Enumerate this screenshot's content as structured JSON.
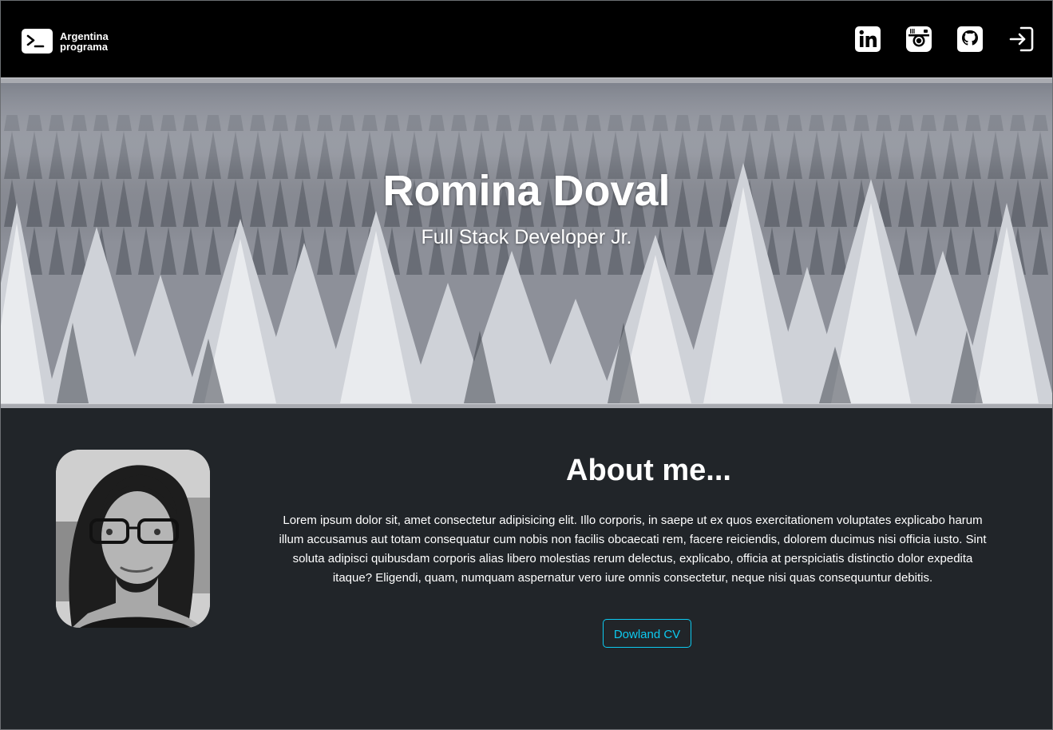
{
  "navbar": {
    "brand_line1": "Argentina",
    "brand_line2": "programa",
    "brand_icon": "terminal-icon",
    "icons": [
      {
        "name": "linkedin-icon",
        "label": "LinkedIn"
      },
      {
        "name": "instagram-icon",
        "label": "Instagram"
      },
      {
        "name": "github-icon",
        "label": "GitHub"
      },
      {
        "name": "login-icon",
        "label": "Login"
      }
    ]
  },
  "hero": {
    "title": "Romina Doval",
    "subtitle": "Full Stack Developer Jr."
  },
  "about": {
    "title": "About me...",
    "text": "Lorem ipsum dolor sit, amet consectetur adipisicing elit. Illo corporis, in saepe ut ex quos exercitationem voluptates explicabo harum illum accusamus aut totam consequatur cum nobis non facilis obcaecati rem, facere reiciendis, dolorem ducimus nisi officia iusto. Sint soluta adipisci quibusdam corporis alias libero molestias rerum delectus, explicabo, officia at perspiciatis distinctio dolor expedita itaque? Eligendi, quam, numquam aspernatur vero iure omnis consectetur, neque nisi quas consequuntur debitis.",
    "cv_button": "Dowland CV"
  },
  "colors": {
    "navbar_bg": "#000000",
    "page_bg": "#212529",
    "accent": "#0dcaf0",
    "separator": "#a9abb1"
  }
}
